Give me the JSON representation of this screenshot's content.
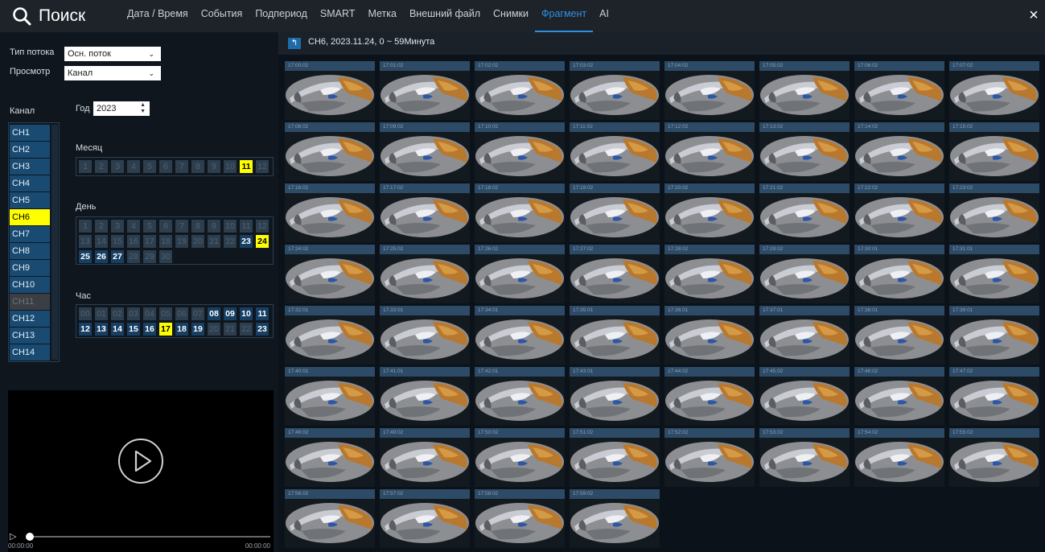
{
  "header": {
    "title": "Поиск",
    "tabs": [
      {
        "label": "Дата / Время",
        "active": false
      },
      {
        "label": "События",
        "active": false
      },
      {
        "label": "Подпериод",
        "active": false
      },
      {
        "label": "SMART",
        "active": false
      },
      {
        "label": "Метка",
        "active": false
      },
      {
        "label": "Внешний файл",
        "active": false
      },
      {
        "label": "Снимки",
        "active": false
      },
      {
        "label": "Фрагмент",
        "active": true
      },
      {
        "label": "AI",
        "active": false
      }
    ],
    "close_icon": "×",
    "accent_color": "#2f8fe0"
  },
  "left": {
    "stream_type_label": "Тип потока",
    "stream_type_value": "Осн. поток",
    "view_label": "Просмотр",
    "view_value": "Канал",
    "channel_label": "Канал",
    "year_label": "Год",
    "year_value": "2023",
    "channels": [
      {
        "label": "CH1",
        "state": "normal"
      },
      {
        "label": "CH2",
        "state": "normal"
      },
      {
        "label": "CH3",
        "state": "normal"
      },
      {
        "label": "CH4",
        "state": "normal"
      },
      {
        "label": "CH5",
        "state": "normal"
      },
      {
        "label": "CH6",
        "state": "selected"
      },
      {
        "label": "CH7",
        "state": "normal"
      },
      {
        "label": "CH8",
        "state": "normal"
      },
      {
        "label": "CH9",
        "state": "normal"
      },
      {
        "label": "CH10",
        "state": "normal"
      },
      {
        "label": "CH11",
        "state": "disabled"
      },
      {
        "label": "CH12",
        "state": "normal"
      },
      {
        "label": "CH13",
        "state": "normal"
      },
      {
        "label": "CH14",
        "state": "normal"
      }
    ],
    "month_label": "Месяц",
    "months": [
      {
        "v": "1",
        "s": "dis"
      },
      {
        "v": "2",
        "s": "dis"
      },
      {
        "v": "3",
        "s": "dis"
      },
      {
        "v": "4",
        "s": "dis"
      },
      {
        "v": "5",
        "s": "dis"
      },
      {
        "v": "6",
        "s": "dis"
      },
      {
        "v": "7",
        "s": "dis"
      },
      {
        "v": "8",
        "s": "dis"
      },
      {
        "v": "9",
        "s": "dis"
      },
      {
        "v": "10",
        "s": "dis"
      },
      {
        "v": "11",
        "s": "sel"
      },
      {
        "v": "12",
        "s": "dis"
      }
    ],
    "day_label": "День",
    "days": [
      {
        "v": "1",
        "s": "dis"
      },
      {
        "v": "2",
        "s": "dis"
      },
      {
        "v": "3",
        "s": "dis"
      },
      {
        "v": "4",
        "s": "dis"
      },
      {
        "v": "5",
        "s": "dis"
      },
      {
        "v": "6",
        "s": "dis"
      },
      {
        "v": "7",
        "s": "dis"
      },
      {
        "v": "8",
        "s": "dis"
      },
      {
        "v": "9",
        "s": "dis"
      },
      {
        "v": "10",
        "s": "dis"
      },
      {
        "v": "11",
        "s": "dis"
      },
      {
        "v": "12",
        "s": "dis"
      },
      {
        "v": "13",
        "s": "dis"
      },
      {
        "v": "14",
        "s": "dis"
      },
      {
        "v": "15",
        "s": "dis"
      },
      {
        "v": "16",
        "s": "dis"
      },
      {
        "v": "17",
        "s": "dis"
      },
      {
        "v": "18",
        "s": "dis"
      },
      {
        "v": "19",
        "s": "dis"
      },
      {
        "v": "20",
        "s": "dis"
      },
      {
        "v": "21",
        "s": "dis"
      },
      {
        "v": "22",
        "s": "dis"
      },
      {
        "v": "23",
        "s": "av"
      },
      {
        "v": "24",
        "s": "sel"
      },
      {
        "v": "25",
        "s": "av"
      },
      {
        "v": "26",
        "s": "av"
      },
      {
        "v": "27",
        "s": "av"
      },
      {
        "v": "28",
        "s": "dis"
      },
      {
        "v": "29",
        "s": "dis"
      },
      {
        "v": "30",
        "s": "dis"
      }
    ],
    "hour_label": "Час",
    "hours": [
      {
        "v": "00",
        "s": "dis"
      },
      {
        "v": "01",
        "s": "dis"
      },
      {
        "v": "02",
        "s": "dis"
      },
      {
        "v": "03",
        "s": "dis"
      },
      {
        "v": "04",
        "s": "dis"
      },
      {
        "v": "05",
        "s": "dis"
      },
      {
        "v": "06",
        "s": "dis"
      },
      {
        "v": "07",
        "s": "dis"
      },
      {
        "v": "08",
        "s": "av"
      },
      {
        "v": "09",
        "s": "av"
      },
      {
        "v": "10",
        "s": "av"
      },
      {
        "v": "11",
        "s": "av"
      },
      {
        "v": "12",
        "s": "av"
      },
      {
        "v": "13",
        "s": "av"
      },
      {
        "v": "14",
        "s": "av"
      },
      {
        "v": "15",
        "s": "av"
      },
      {
        "v": "16",
        "s": "av"
      },
      {
        "v": "17",
        "s": "sel"
      },
      {
        "v": "18",
        "s": "av"
      },
      {
        "v": "19",
        "s": "av"
      },
      {
        "v": "20",
        "s": "dis"
      },
      {
        "v": "21",
        "s": "dis"
      },
      {
        "v": "22",
        "s": "dis"
      },
      {
        "v": "23",
        "s": "av"
      }
    ],
    "player": {
      "time_start": "00:00:00",
      "time_end": "00:00:00",
      "progress": 0
    }
  },
  "right": {
    "breadcrumb": "CH6,  2023.11.24,  0 ~ 59Минута",
    "thumbnails": [
      "17:00:02",
      "17:01:02",
      "17:02:02",
      "17:03:02",
      "17:04:02",
      "17:05:02",
      "17:06:02",
      "17:07:02",
      "17:08:02",
      "17:09:02",
      "17:10:02",
      "17:11:02",
      "17:12:02",
      "17:13:02",
      "17:14:02",
      "17:15:02",
      "17:16:02",
      "17:17:02",
      "17:18:02",
      "17:19:02",
      "17:20:02",
      "17:21:02",
      "17:22:02",
      "17:23:02",
      "17:24:02",
      "17:25:02",
      "17:26:02",
      "17:27:02",
      "17:28:02",
      "17:29:02",
      "17:30:01",
      "17:31:01",
      "17:32:01",
      "17:33:01",
      "17:34:01",
      "17:35:01",
      "17:36:01",
      "17:37:01",
      "17:38:01",
      "17:39:01",
      "17:40:01",
      "17:41:01",
      "17:42:01",
      "17:43:01",
      "17:44:02",
      "17:45:02",
      "17:46:02",
      "17:47:02",
      "17:48:02",
      "17:49:02",
      "17:50:02",
      "17:51:02",
      "17:52:02",
      "17:53:02",
      "17:54:02",
      "17:55:02",
      "17:56:02",
      "17:57:02",
      "17:58:02",
      "17:59:02"
    ]
  }
}
